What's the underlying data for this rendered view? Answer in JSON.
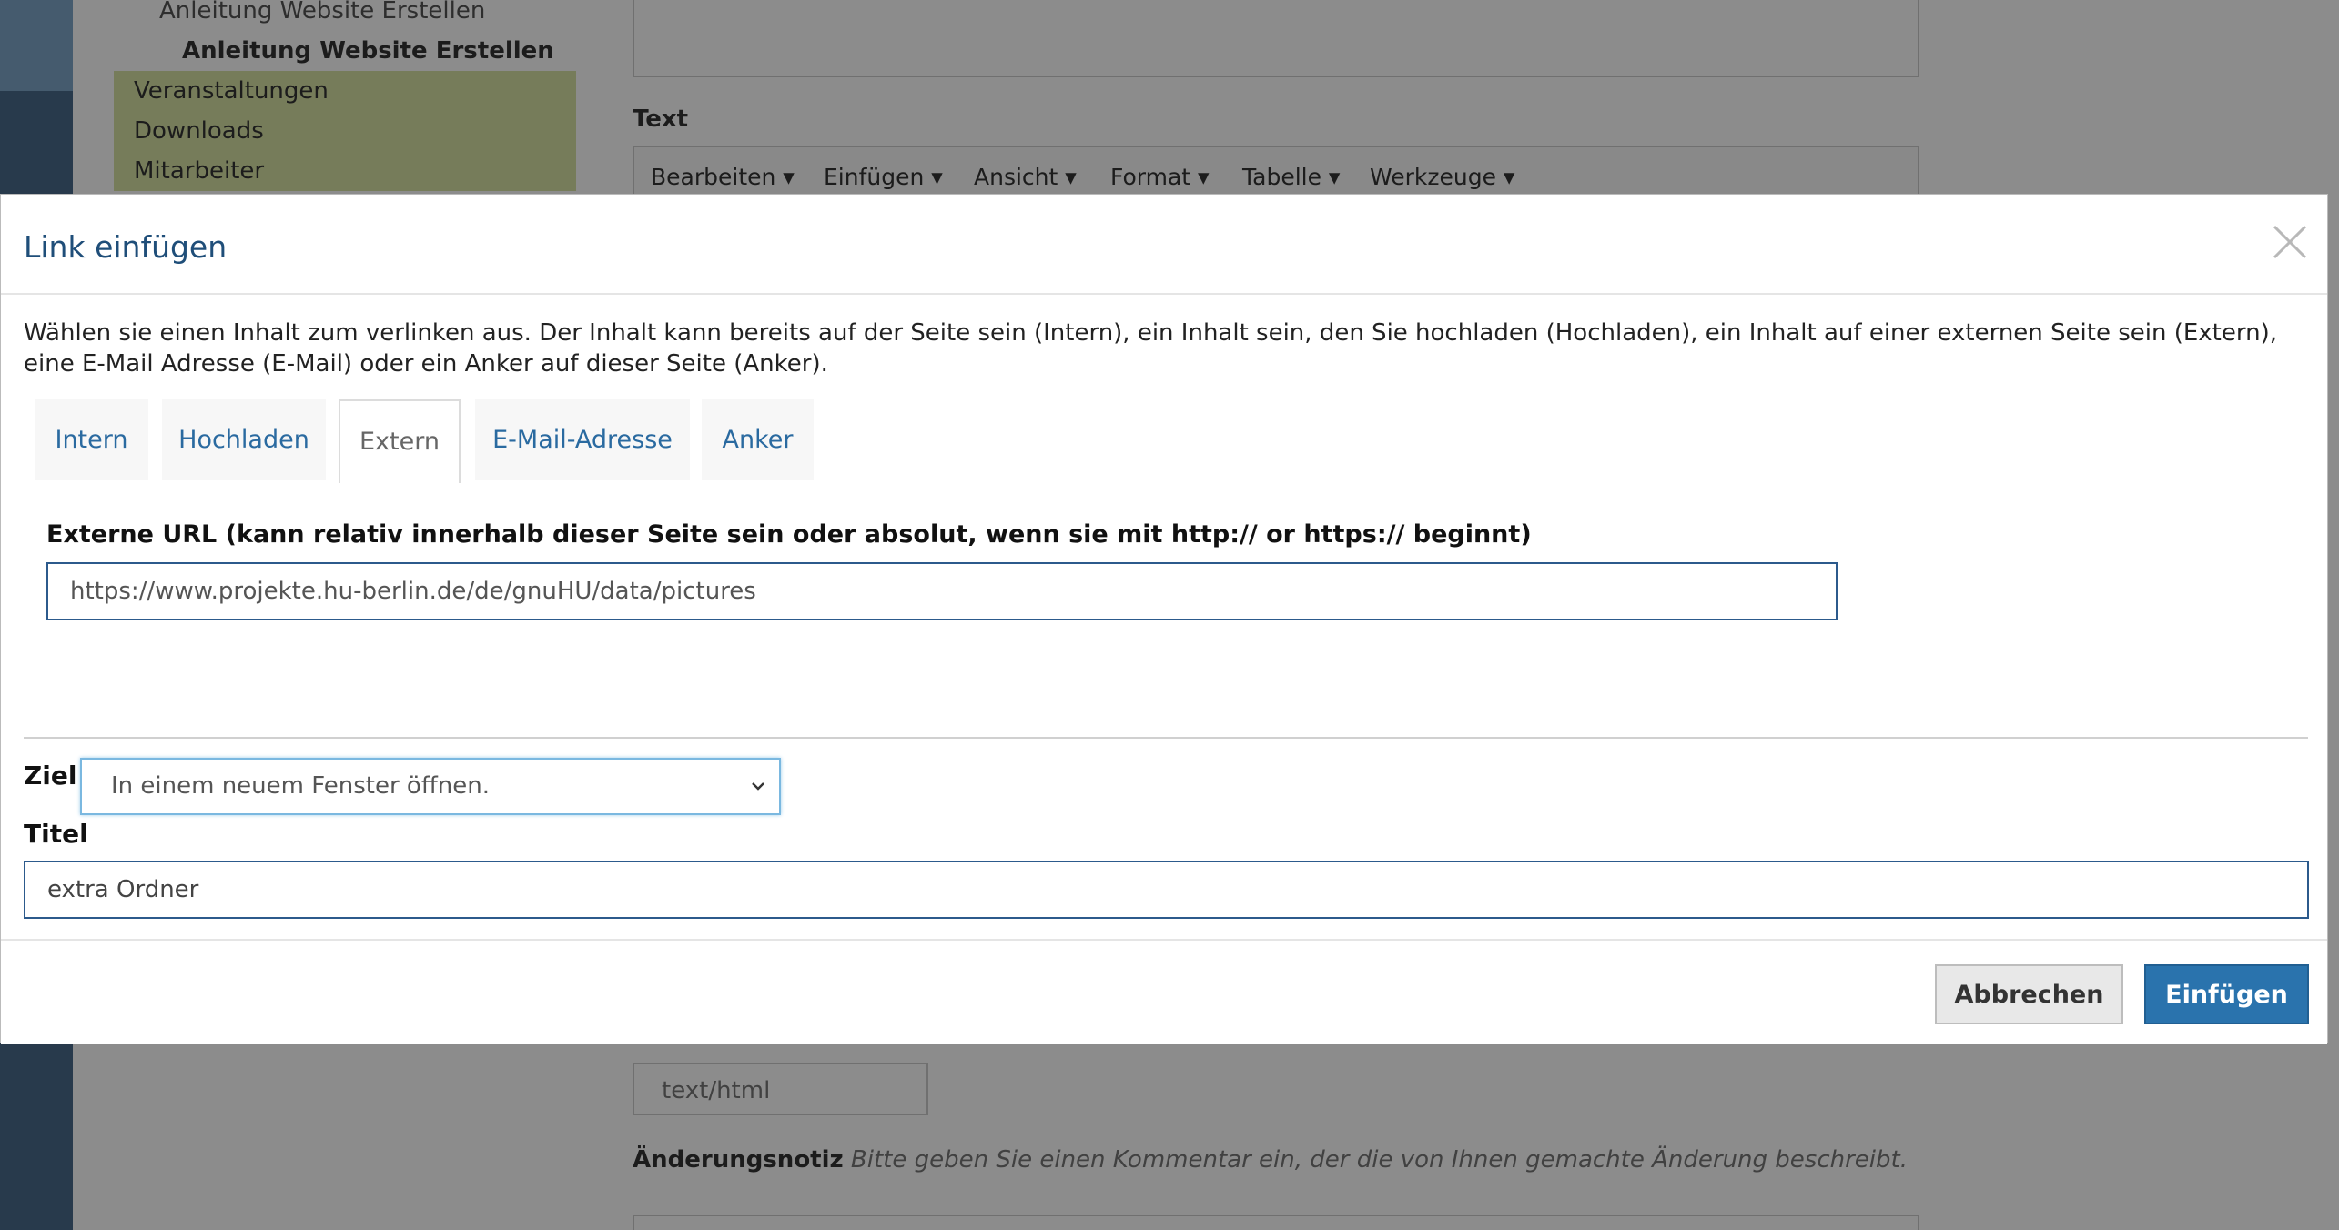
{
  "background": {
    "nav_items": [
      "Anleitung Website Erstellen",
      "Anleitung Website Erstellen",
      "Veranstaltungen",
      "Downloads",
      "Mitarbeiter"
    ],
    "text_label": "Text",
    "editor_menu": [
      "Bearbeiten ▾",
      "Einfügen ▾",
      "Ansicht ▾",
      "Format ▾",
      "Tabelle ▾",
      "Werkzeuge ▾"
    ],
    "format_select": "text/html",
    "change_note_label": "Änderungsnotiz",
    "change_note_help": "Bitte geben Sie einen Kommentar ein, der die von Ihnen gemachte Änderung beschreibt."
  },
  "modal": {
    "title": "Link einfügen",
    "intro": "Wählen sie einen Inhalt zum verlinken aus. Der Inhalt kann bereits auf der Seite sein (Intern), ein Inhalt sein, den Sie hochladen (Hochladen), ein Inhalt auf einer externen Seite sein (Extern), eine E-Mail Adresse (E-Mail) oder ein Anker auf dieser Seite (Anker).",
    "tabs": [
      {
        "label": "Intern",
        "active": false
      },
      {
        "label": "Hochladen",
        "active": false
      },
      {
        "label": "Extern",
        "active": true
      },
      {
        "label": "E-Mail-Adresse",
        "active": false
      },
      {
        "label": "Anker",
        "active": false
      }
    ],
    "url_label": "Externe URL (kann relativ innerhalb dieser Seite sein oder absolut, wenn sie mit http:// or https:// beginnt)",
    "url_value": "https://www.projekte.hu-berlin.de/de/gnuHU/data/pictures",
    "ziel_label": "Ziel",
    "ziel_value": "In einem neuem Fenster öffnen.",
    "titel_label": "Titel",
    "titel_value": "extra Ordner",
    "cancel_label": "Abbrechen",
    "insert_label": "Einfügen"
  },
  "colors": {
    "accent": "#2a73ad",
    "title": "#1f4e79",
    "tab_text": "#2a6aa0"
  }
}
